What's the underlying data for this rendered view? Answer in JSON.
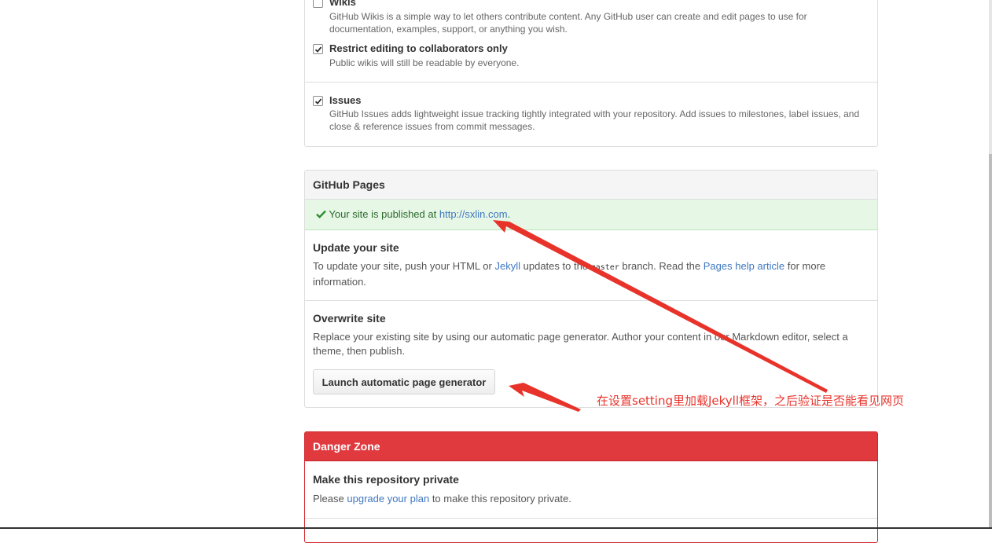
{
  "features": {
    "wikis": {
      "title": "Wikis",
      "description": "GitHub Wikis is a simple way to let others contribute content. Any GitHub user can create and edit pages to use for documentation, examples, support, or anything you wish.",
      "checked": true
    },
    "restrict": {
      "title": "Restrict editing to collaborators only",
      "description": "Public wikis will still be readable by everyone.",
      "checked": true
    },
    "issues": {
      "title": "Issues",
      "description": "GitHub Issues adds lightweight issue tracking tightly integrated with your repository. Add issues to milestones, label issues, and close & reference issues from commit messages.",
      "checked": true
    }
  },
  "pages": {
    "header": "GitHub Pages",
    "published_prefix": "Your site is published at",
    "published_url": "http://sxlin.com",
    "published_suffix": ".",
    "update": {
      "title": "Update your site",
      "text1": "To update your site, push your HTML or",
      "jekyll_link": "Jekyll",
      "text2": "updates to the",
      "branch": "master",
      "text3": "branch. Read the",
      "help_link": "Pages help article",
      "text4": "for more information."
    },
    "overwrite": {
      "title": "Overwrite site",
      "description": "Replace your existing site by using our automatic page generator. Author your content in our Markdown editor, select a theme, then publish.",
      "button": "Launch automatic page generator"
    }
  },
  "danger": {
    "header": "Danger Zone",
    "private_title": "Make this repository private",
    "private_text1": "Please",
    "private_link": "upgrade your plan",
    "private_text2": "to make this repository private."
  },
  "annotation": {
    "text": "在设置setting里加载Jekyll框架，之后验证是否能看见网页",
    "color": "#e8332b"
  },
  "colors": {
    "success_bg": "#e6f7e6",
    "success_border": "#bde5bd",
    "success_text": "#2d6a2d",
    "danger_bg": "#e03a3f",
    "link": "#4078c0"
  }
}
